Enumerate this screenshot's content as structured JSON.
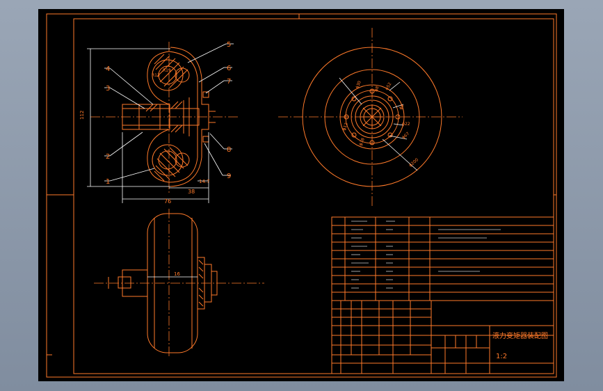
{
  "drawing": {
    "title": "液力变矩器装配图",
    "scale": "1:2",
    "part_numbers": [
      "1",
      "2",
      "3",
      "4",
      "5",
      "6",
      "7",
      "8",
      "9"
    ],
    "dimensions": {
      "height": "112",
      "width": "76",
      "d1": "38",
      "d2": "14.7",
      "shaft": "16",
      "r1": "R13",
      "r2": "R19"
    }
  }
}
